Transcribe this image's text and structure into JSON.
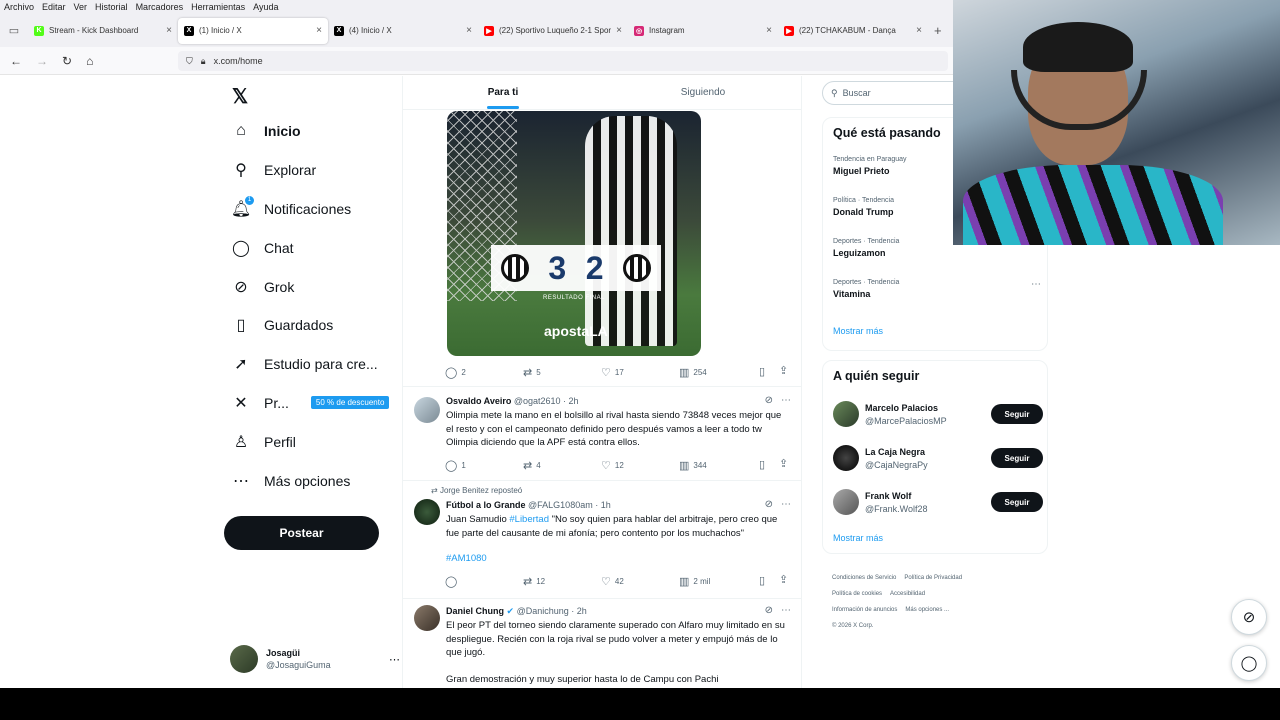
{
  "menubar": [
    "Archivo",
    "Editar",
    "Ver",
    "Historial",
    "Marcadores",
    "Herramientas",
    "Ayuda"
  ],
  "tabs": [
    {
      "title": "Stream - Kick Dashboard",
      "color": "#53fc18",
      "glyph": "K",
      "active": false
    },
    {
      "title": "(1) Inicio / X",
      "color": "#000000",
      "glyph": "X",
      "active": true
    },
    {
      "title": "(4) Inicio / X",
      "color": "#000000",
      "glyph": "X",
      "active": false
    },
    {
      "title": "(22) Sportivo Luqueño 2-1 Spor",
      "color": "#ff0000",
      "glyph": "▶",
      "active": false
    },
    {
      "title": "Instagram",
      "color": "#d62976",
      "glyph": "◎",
      "active": false
    },
    {
      "title": "(22) TCHAKABUM - Dança",
      "color": "#ff0000",
      "glyph": "▶",
      "active": false
    }
  ],
  "url": "x.com/home",
  "sidebar": {
    "items": [
      {
        "label": "Inicio",
        "icon": "home-icon",
        "glyph": "⌂",
        "bold": true
      },
      {
        "label": "Explorar",
        "icon": "search-icon",
        "glyph": "⚲"
      },
      {
        "label": "Notificaciones",
        "icon": "bell-icon",
        "glyph": "🔔︎",
        "badge": "1"
      },
      {
        "label": "Chat",
        "icon": "chat-icon",
        "glyph": "◯"
      },
      {
        "label": "Grok",
        "icon": "grok-icon",
        "glyph": "⊘"
      },
      {
        "label": "Guardados",
        "icon": "bookmark-icon",
        "glyph": "▯"
      },
      {
        "label": "Estudio para cre...",
        "icon": "rocket-icon",
        "glyph": "➚"
      },
      {
        "label": "Pr...",
        "icon": "x-premium-icon",
        "glyph": "✕",
        "promo": "50 % de descuento"
      },
      {
        "label": "Perfil",
        "icon": "person-icon",
        "glyph": "♙"
      },
      {
        "label": "Más opciones",
        "icon": "more-circle-icon",
        "glyph": "⋯"
      }
    ],
    "post_label": "Postear",
    "account_name": "Josagüi",
    "account_handle": "@JosaguiGuma"
  },
  "feed": {
    "tabs": [
      "Para ti",
      "Siguiendo"
    ],
    "media": {
      "score_left": "3",
      "score_right": "2",
      "caption": "RESULTADO FINAL",
      "brand": "apostaLA"
    },
    "first_actions": {
      "replies": "2",
      "reposts": "5",
      "likes": "17",
      "views": "254"
    },
    "tweets": [
      {
        "name": "Osvaldo Aveiro",
        "meta": "@ogat2610 · 2h",
        "text": "Olimpia mete la mano en el bolsillo al rival hasta siendo 73848 veces mejor que el resto y con el campeonato definido pero después vamos a leer a todo tw Olimpia diciendo que la APF está contra ellos.",
        "replies": "1",
        "reposts": "4",
        "likes": "12",
        "views": "344"
      },
      {
        "reposted_by": "Jorge Benitez reposteó",
        "name": "Fútbol a lo Grande",
        "meta": "@FALG1080am · 1h",
        "text_prefix": "Juan Samudio ",
        "text_link": "#Libertad",
        "text_rest": " \"No soy quien para hablar del arbitraje, pero creo que fue parte del causante de mi afonía; pero contento por los muchachos\"",
        "hashtag": "#AM1080",
        "replies": "",
        "reposts": "12",
        "likes": "42",
        "views": "2 mil"
      },
      {
        "name": "Daniel Chung",
        "meta": "@Danichung · 2h",
        "text": "El peor PT del torneo siendo claramente superado con Alfaro muy limitado en su despliegue. Recién con la roja rival se pudo volver a meter y empujó más de lo que jugó.",
        "text2": "Gran demostración y muy superior hasta lo de Campu con Pachi"
      }
    ]
  },
  "right": {
    "search_placeholder": "Buscar",
    "trends_title": "Qué está pasando",
    "trends": [
      {
        "category": "Tendencia en Paraguay",
        "name": "Miguel Prieto"
      },
      {
        "category": "Política · Tendencia",
        "name": "Donald Trump"
      },
      {
        "category": "Deportes · Tendencia",
        "name": "Leguizamon"
      },
      {
        "category": "Deportes · Tendencia",
        "name": "Vitamina"
      }
    ],
    "show_more": "Mostrar más",
    "follow_title": "A quién seguir",
    "follow": [
      {
        "name": "Marcelo Palacios",
        "handle": "@MarcePalaciosMP",
        "button": "Seguir"
      },
      {
        "name": "La Caja Negra",
        "handle": "@CajaNegraPy",
        "button": "Seguir"
      },
      {
        "name": "Frank Wolf",
        "handle": "@Frank.Wolf28",
        "button": "Seguir"
      }
    ],
    "footer": [
      "Condiciones de Servicio",
      "Política de Privacidad",
      "Política de cookies",
      "Accesibilidad",
      "Información de anuncios",
      "Más opciones ...",
      "© 2026 X Corp."
    ]
  }
}
